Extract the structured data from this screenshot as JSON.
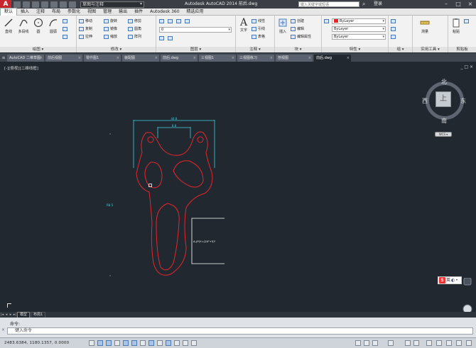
{
  "titlebar": {
    "app_letter": "A",
    "workspace": "草图与注释",
    "title": "Autodesk AutoCAD 2014    前后.dwg",
    "search_placeholder": "键入关键字或短语",
    "signin": "登录"
  },
  "ribbon_tabs": [
    "默认",
    "插入",
    "注释",
    "布局",
    "参数化",
    "视图",
    "管理",
    "输出",
    "插件",
    "Autodesk 360",
    "精选应用"
  ],
  "ribbon": {
    "draw": {
      "title": "绘图 ▾",
      "line": "直线",
      "polyline": "多段线",
      "circle": "圆",
      "arc": "圆弧"
    },
    "modify": {
      "title": "修改 ▾",
      "items": [
        "移动",
        "旋转",
        "修剪",
        "复制",
        "镜像",
        "圆角",
        "拉伸",
        "缩放",
        "阵列"
      ]
    },
    "layers": {
      "title": "图层 ▾",
      "combo": "0"
    },
    "annotation": {
      "title": "注释 ▾",
      "text": "文字",
      "items": [
        "线性",
        "引线",
        "表格"
      ]
    },
    "block": {
      "title": "块 ▾",
      "insert": "插入",
      "items": [
        "创建",
        "编辑",
        "编辑属性"
      ]
    },
    "properties": {
      "title": "特性 ▾",
      "color": "ByLayer",
      "linetype": "ByLayer",
      "lineweight": "ByLayer"
    },
    "groups": {
      "title": "组 ▾"
    },
    "utilities": {
      "title": "实用工具 ▾",
      "measure": "测量"
    },
    "clipboard": {
      "title": "剪贴板",
      "paste": "粘贴"
    }
  },
  "file_tabs": [
    "AutoCAD 二维草图",
    "前后视图",
    "零件图1",
    "装配图",
    "前后.dwg",
    "三视图1",
    "三视图练习",
    "剖视图",
    "前后.dwg"
  ],
  "drawing": {
    "viewport_label": "[-][俯视][二维线框]",
    "viewport_ctrls": "_ □ ×",
    "viewcube": {
      "north": "北",
      "south": "南",
      "east": "东",
      "west": "西",
      "face": "上",
      "wcs": "WCS ▾"
    },
    "dim_top": "44.8",
    "dim_inner": "8.8",
    "dim_left": "R8.5",
    "label_box": "A-(P)Y=(2X²+5)²"
  },
  "ime": {
    "icon": "S",
    "text": "英"
  },
  "layout_tabs": [
    "模型",
    "布局1"
  ],
  "command": {
    "history": "命令:",
    "placeholder": "键入命令"
  },
  "status": {
    "coords": "2483.6384, 1180.1357, 0.0000"
  },
  "colors": {
    "canvas": "#212830",
    "red_geometry": "#e8262c",
    "cyan_dimension": "#3fd0e0"
  }
}
